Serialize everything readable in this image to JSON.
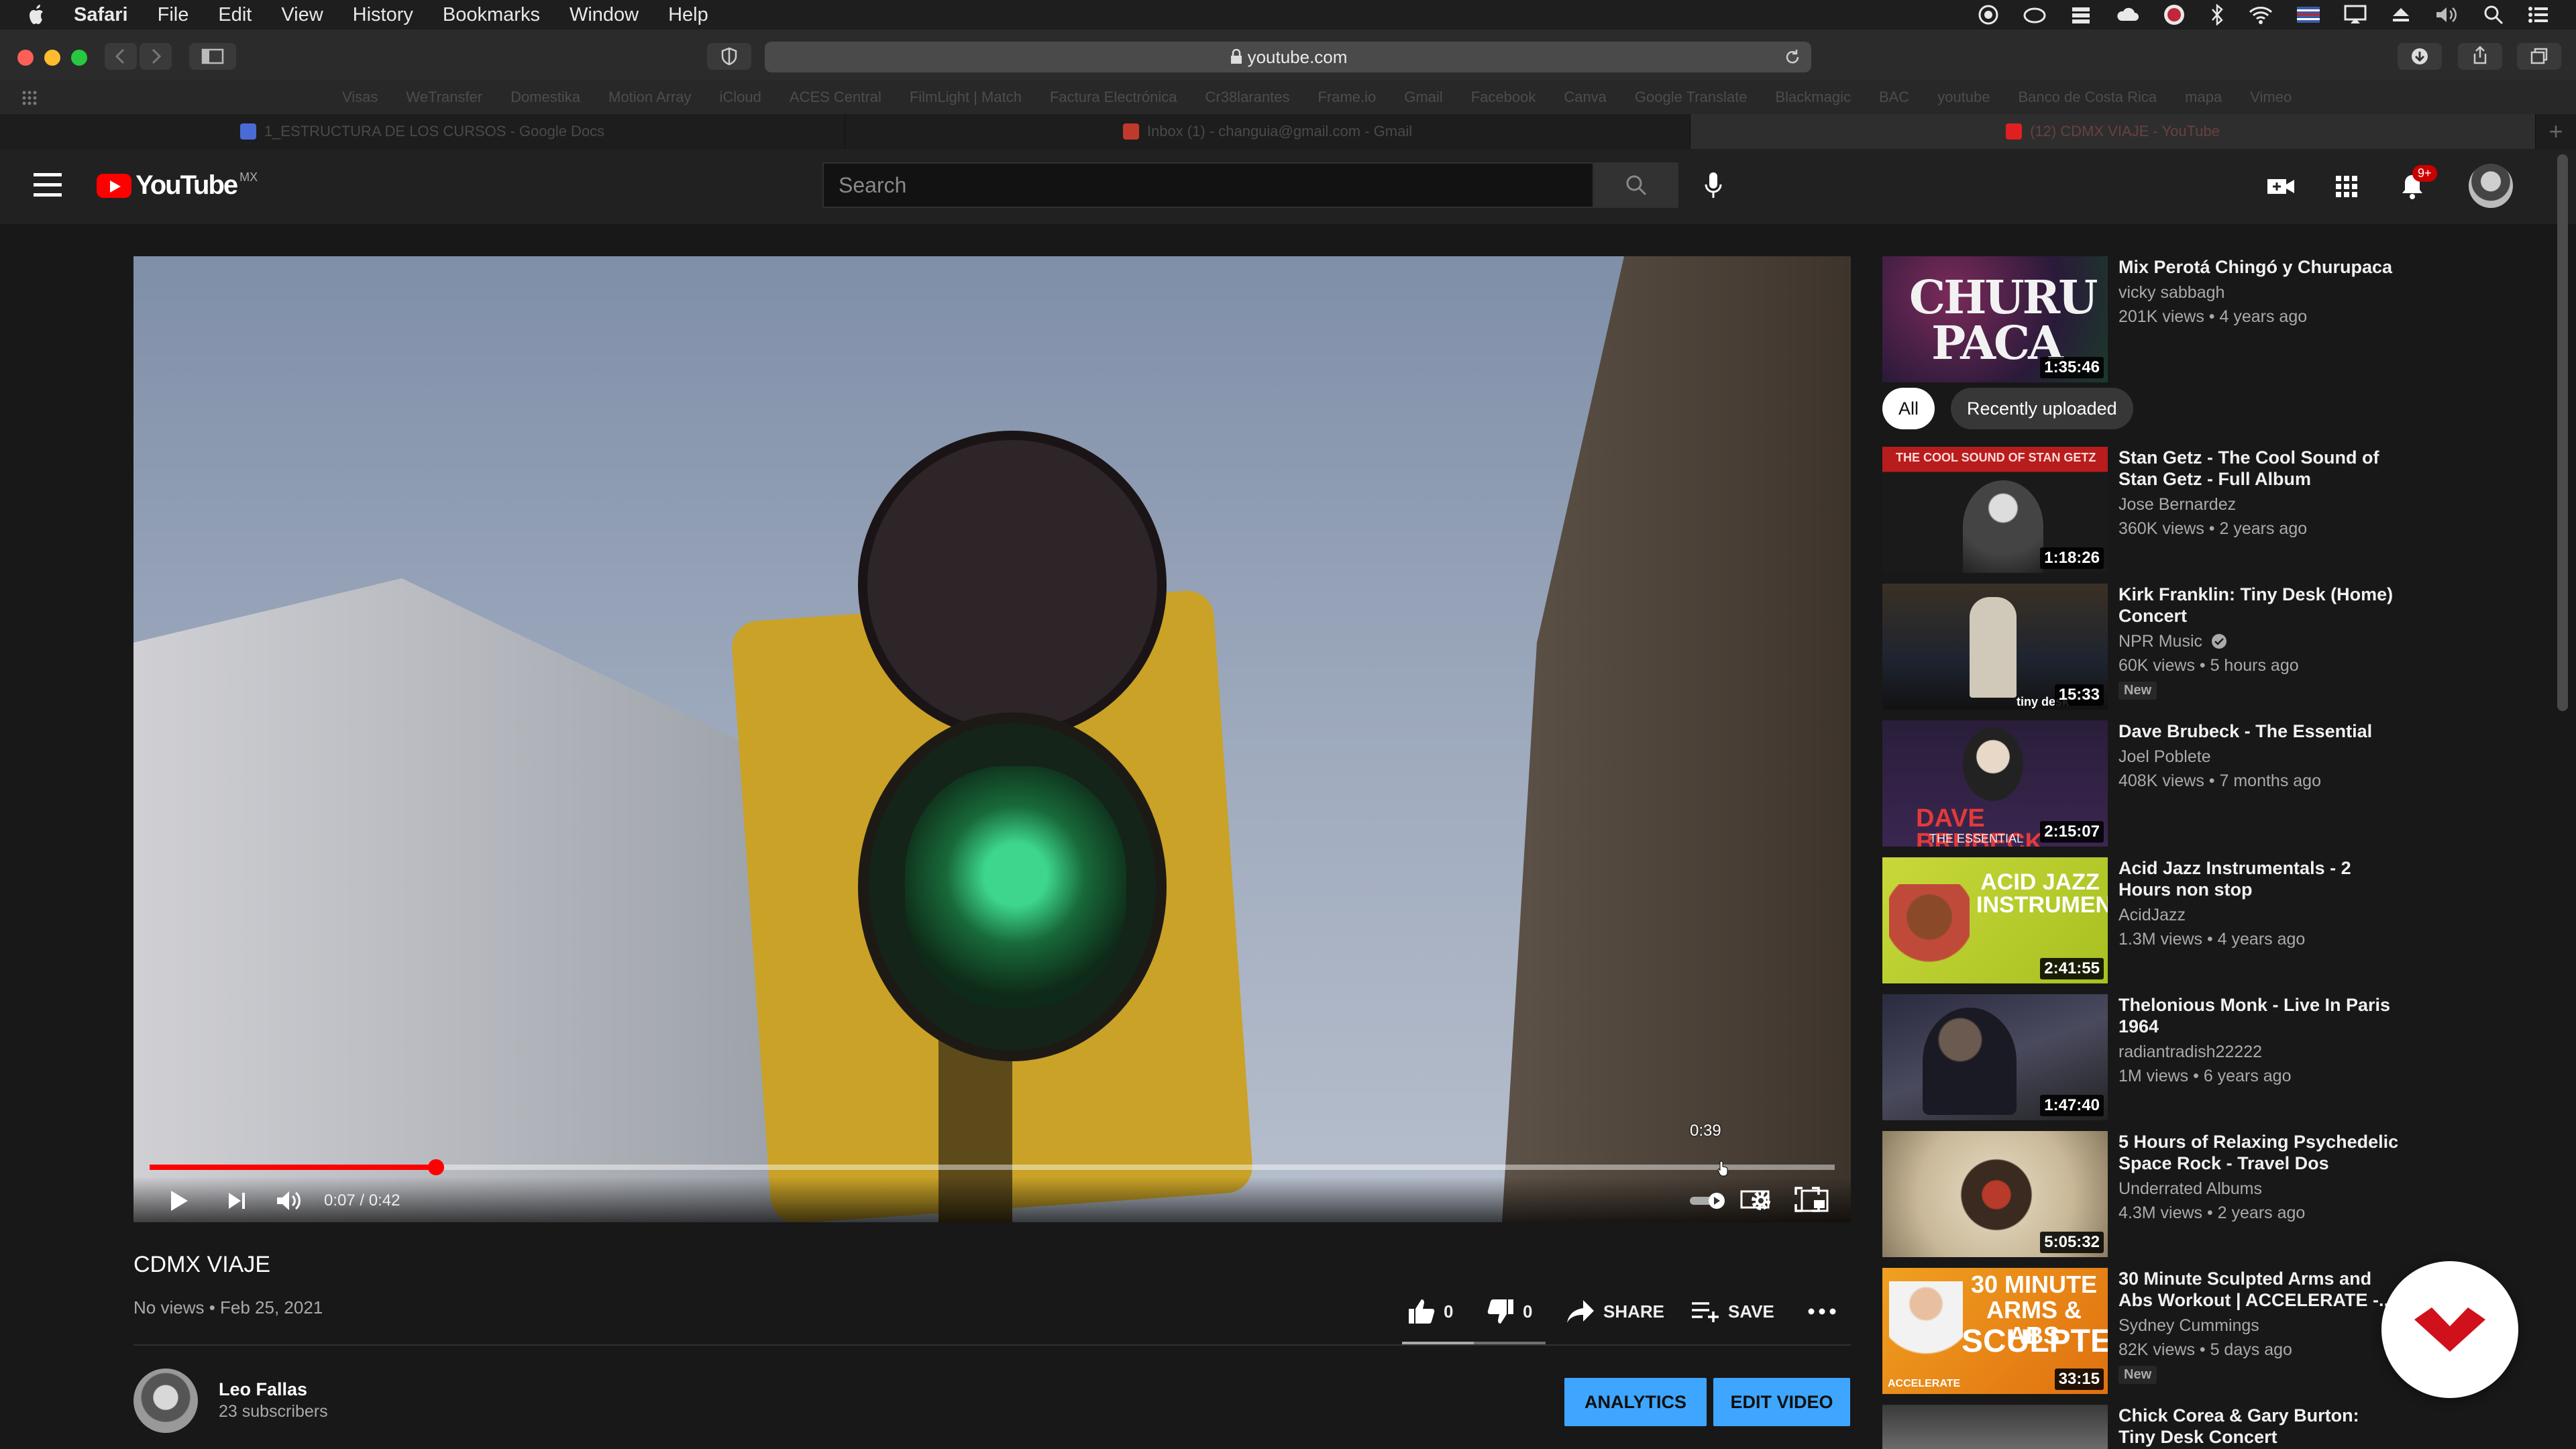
{
  "menubar": {
    "app": "Safari",
    "items": [
      "File",
      "Edit",
      "View",
      "History",
      "Bookmarks",
      "Window",
      "Help"
    ]
  },
  "browser": {
    "url": "youtube.com",
    "favorites": [
      "Visas",
      "WeTransfer",
      "Domestika",
      "Motion Array",
      "iCloud",
      "ACES Central",
      "FilmLight | Match",
      "Factura Electrónica",
      "Cr38larantes",
      "Frame.io",
      "Gmail",
      "Facebook",
      "Canva",
      "Google Translate",
      "Blackmagic",
      "BAC",
      "youtube",
      "Banco de Costa Rica",
      "mapa",
      "Vimeo"
    ],
    "tabs": [
      {
        "label": "1_ESTRUCTURA DE LOS CURSOS - Google Docs",
        "color": "#4a6ad6"
      },
      {
        "label": "Inbox (1) - changuia@gmail.com - Gmail",
        "color": "#c03a2b"
      },
      {
        "label": "(12) CDMX VIAJE - YouTube",
        "color": "#e02020"
      }
    ]
  },
  "youtube": {
    "logo_text": "YouTube",
    "country_code": "MX",
    "search_placeholder": "Search",
    "notification_count": "9+"
  },
  "player": {
    "progress_fraction": 0.17,
    "current_time": "0:07",
    "duration": "0:42",
    "time_display": "0:07 / 0:42",
    "hover_time": "0:39"
  },
  "video": {
    "title": "CDMX VIAJE",
    "meta": "No views • Feb 25, 2021",
    "likes": "0",
    "dislikes": "0",
    "share_label": "SHARE",
    "save_label": "SAVE",
    "channel_name": "Leo Fallas",
    "subscribers": "23 subscribers",
    "analytics_label": "ANALYTICS",
    "edit_label": "EDIT VIDEO"
  },
  "chips": [
    "All",
    "Recently uploaded"
  ],
  "recommendations": [
    {
      "title": "Mix Perotá Chingó y Churupaca",
      "channel": "vicky sabbagh",
      "views": "201K views • 4 years ago",
      "duration": "1:35:46",
      "thumb": "churupaca"
    },
    {
      "title": "Stan Getz - The Cool Sound of Stan Getz - Full Album",
      "channel": "Jose Bernardez",
      "views": "360K views • 2 years ago",
      "duration": "1:18:26",
      "thumb": "getz"
    },
    {
      "title": "Kirk Franklin: Tiny Desk (Home) Concert",
      "channel": "NPR Music",
      "verified": true,
      "views": "60K views • 5 hours ago",
      "badge": "New",
      "duration": "15:33",
      "thumb": "tinydesk"
    },
    {
      "title": "Dave Brubeck - The Essential",
      "channel": "Joel Poblete",
      "views": "408K views • 7 months ago",
      "duration": "2:15:07",
      "thumb": "brubeck"
    },
    {
      "title": "Acid Jazz Instrumentals - 2 Hours non stop",
      "channel": "AcidJazz",
      "views": "1.3M views • 4 years ago",
      "duration": "2:41:55",
      "thumb": "acidjazz"
    },
    {
      "title": "Thelonious Monk - Live In Paris 1964",
      "channel": "radiantradish22222",
      "views": "1M views • 6 years ago",
      "duration": "1:47:40",
      "thumb": "monk"
    },
    {
      "title": "5 Hours of Relaxing Psychedelic Space Rock - Travel Dos",
      "channel": "Underrated Albums",
      "views": "4.3M views • 2 years ago",
      "duration": "5:05:32",
      "thumb": "space"
    },
    {
      "title": "30 Minute Sculpted Arms and Abs Workout | ACCELERATE -...",
      "channel": "Sydney Cummings",
      "views": "82K views • 5 days ago",
      "badge": "New",
      "duration": "33:15",
      "thumb": "workout"
    },
    {
      "title": "Chick Corea & Gary Burton: Tiny Desk Concert",
      "channel": "",
      "views": "",
      "duration": "",
      "thumb": "corea"
    }
  ],
  "thumb_text": {
    "churupaca": "CHURU PACA",
    "getz": "THE COOL SOUND OF STAN GETZ",
    "tinydesk": "tiny desk concerts",
    "brubeck": "DAVE BRUBECK",
    "brubeck_sub": "THE ESSENTIAL",
    "acidjazz": "ACID JAZZ INSTRUMENTALS",
    "workout_top": "30 MINUTE",
    "workout_mid": "ARMS & ABS",
    "workout_bot": "SCULPTED",
    "workout_tag": "ACCELERATE"
  }
}
